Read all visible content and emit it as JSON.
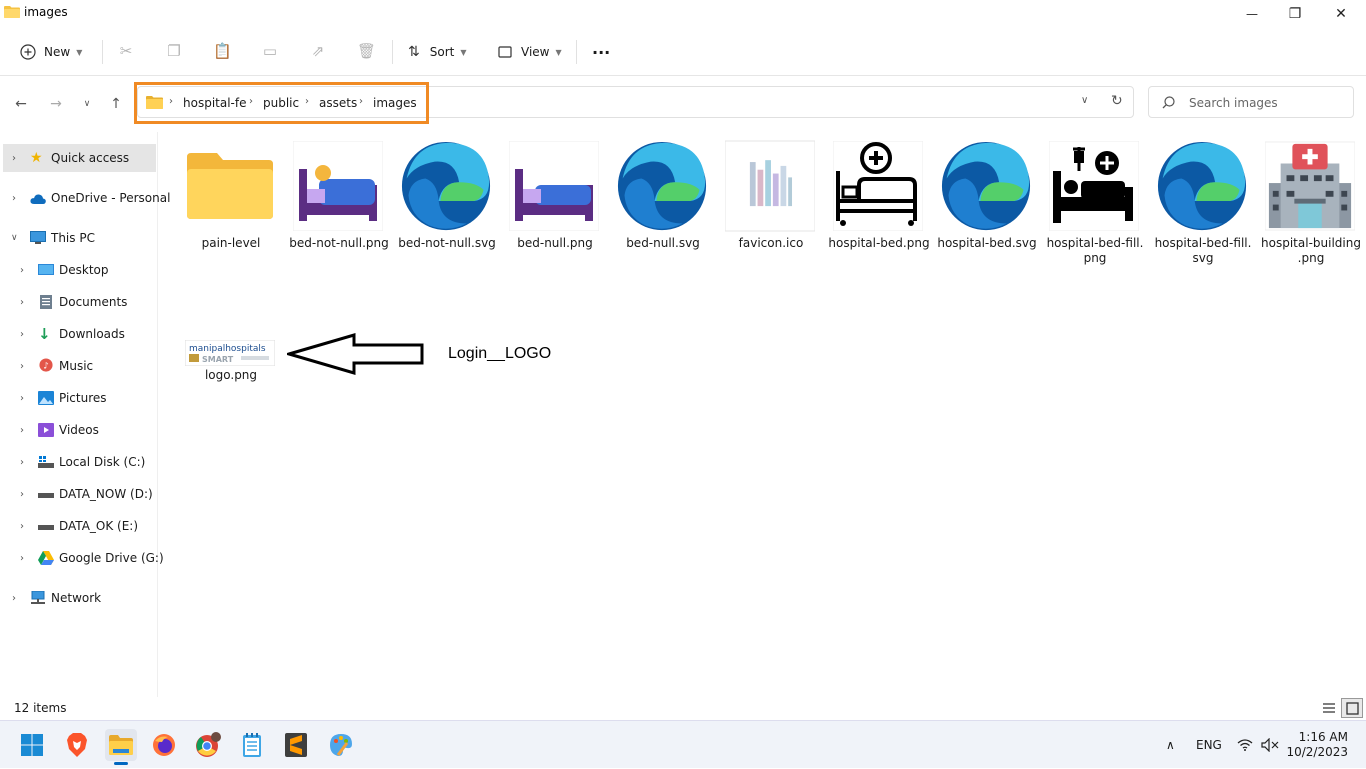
{
  "window": {
    "title": "images",
    "controls": {
      "minimize": "—",
      "maximize": "❐",
      "close": "✕"
    }
  },
  "toolbar": {
    "new_label": "New",
    "sort_label": "Sort",
    "view_label": "View",
    "more_label": "···"
  },
  "address": {
    "crumbs": [
      "hospital-fe",
      "public",
      "assets",
      "images"
    ],
    "search_placeholder": "Search images",
    "highlight_color": "#f08a24"
  },
  "sidebar": {
    "items": [
      {
        "label": "Quick access"
      },
      {
        "label": "OneDrive - Personal"
      },
      {
        "label": "This PC"
      },
      {
        "label": "Desktop"
      },
      {
        "label": "Documents"
      },
      {
        "label": "Downloads"
      },
      {
        "label": "Music"
      },
      {
        "label": "Pictures"
      },
      {
        "label": "Videos"
      },
      {
        "label": "Local Disk (C:)"
      },
      {
        "label": "DATA_NOW (D:)"
      },
      {
        "label": "DATA_OK (E:)"
      },
      {
        "label": "Google Drive (G:)"
      },
      {
        "label": "Network"
      }
    ]
  },
  "files": [
    {
      "name": "pain-level",
      "icon": "folder-icon"
    },
    {
      "name": "bed-not-null.png",
      "icon": "bed-sleeping-icon"
    },
    {
      "name": "bed-not-null.svg",
      "icon": "edge-icon"
    },
    {
      "name": "bed-null.png",
      "icon": "bed-empty-icon"
    },
    {
      "name": "bed-null.svg",
      "icon": "edge-icon"
    },
    {
      "name": "favicon.ico",
      "icon": "favicon-icon"
    },
    {
      "name": "hospital-bed.png",
      "icon": "hospital-bed-outline-icon"
    },
    {
      "name": "hospital-bed.svg",
      "icon": "edge-icon"
    },
    {
      "name": "hospital-bed-fill.\npng",
      "icon": "hospital-bed-fill-icon"
    },
    {
      "name": "hospital-bed-fill.\nsvg",
      "icon": "edge-icon"
    },
    {
      "name": "hospital-building\n.png",
      "icon": "hospital-building-icon"
    },
    {
      "name": "logo.png",
      "icon": "logo-thumbnail"
    }
  ],
  "logo_thumb_text": {
    "line1": "manipalhospitals",
    "line2": "SMART"
  },
  "annotation": {
    "label": "Login__LOGO"
  },
  "status": {
    "count": "12 items"
  },
  "tray": {
    "lang": "ENG",
    "time": "1:16 AM",
    "date": "10/2/2023"
  }
}
